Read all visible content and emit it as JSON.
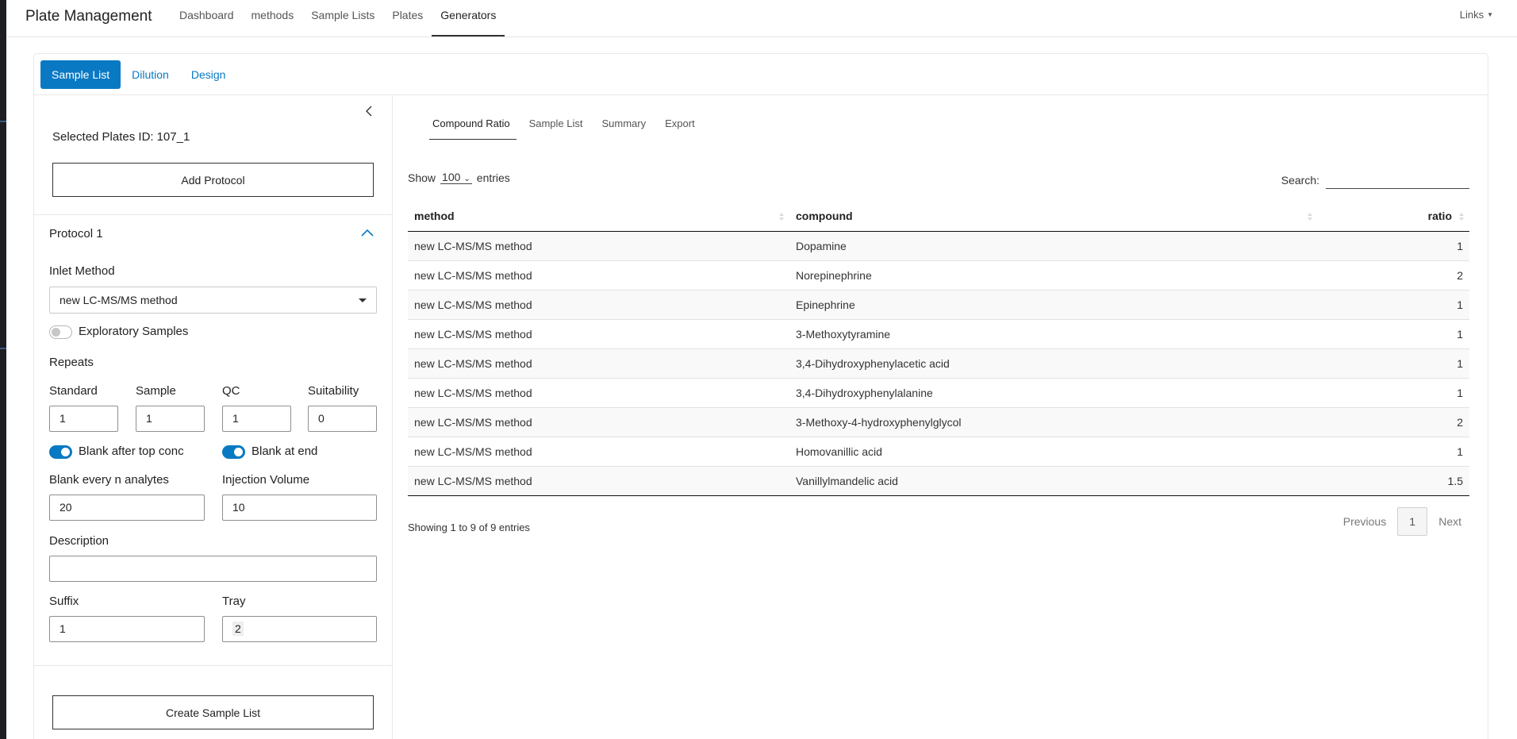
{
  "navbar": {
    "brand": "Plate Management",
    "items": [
      {
        "label": "Dashboard"
      },
      {
        "label": "methods"
      },
      {
        "label": "Sample Lists"
      },
      {
        "label": "Plates"
      },
      {
        "label": "Generators"
      }
    ],
    "active": "Generators",
    "links_label": "Links"
  },
  "generator_tabs": [
    {
      "label": "Sample List"
    },
    {
      "label": "Dilution"
    },
    {
      "label": "Design"
    }
  ],
  "sidebar": {
    "selected_plates_label": "Selected Plates ID:",
    "selected_plates_value": "107_1",
    "add_protocol_label": "Add Protocol",
    "protocol_title": "Protocol 1",
    "inlet_method_label": "Inlet Method",
    "inlet_method_value": "new LC-MS/MS method",
    "exploratory_label": "Exploratory Samples",
    "exploratory_on": false,
    "repeats_label": "Repeats",
    "repeats": [
      {
        "label": "Standard",
        "value": "1"
      },
      {
        "label": "Sample",
        "value": "1"
      },
      {
        "label": "QC",
        "value": "1"
      },
      {
        "label": "Suitability",
        "value": "0"
      }
    ],
    "blank_after_top_label": "Blank after top conc",
    "blank_after_top_on": true,
    "blank_at_end_label": "Blank at end",
    "blank_at_end_on": true,
    "blank_every_label": "Blank every n analytes",
    "blank_every_value": "20",
    "injection_volume_label": "Injection Volume",
    "injection_volume_value": "10",
    "description_label": "Description",
    "description_value": "",
    "suffix_label": "Suffix",
    "suffix_value": "1",
    "tray_label": "Tray",
    "tray_value": "2",
    "create_label": "Create Sample List"
  },
  "main": {
    "tabs": [
      {
        "label": "Compound Ratio"
      },
      {
        "label": "Sample List"
      },
      {
        "label": "Summary"
      },
      {
        "label": "Export"
      }
    ],
    "show_label": "Show",
    "entries_value": "100",
    "entries_label": "entries",
    "search_label": "Search:",
    "columns": [
      "method",
      "compound",
      "ratio"
    ],
    "rows": [
      {
        "method": "new LC-MS/MS method",
        "compound": "Dopamine",
        "ratio": "1"
      },
      {
        "method": "new LC-MS/MS method",
        "compound": "Norepinephrine",
        "ratio": "2"
      },
      {
        "method": "new LC-MS/MS method",
        "compound": "Epinephrine",
        "ratio": "1"
      },
      {
        "method": "new LC-MS/MS method",
        "compound": "3-Methoxytyramine",
        "ratio": "1"
      },
      {
        "method": "new LC-MS/MS method",
        "compound": "3,4-Dihydroxyphenylacetic acid",
        "ratio": "1"
      },
      {
        "method": "new LC-MS/MS method",
        "compound": "3,4-Dihydroxyphenylalanine",
        "ratio": "1"
      },
      {
        "method": "new LC-MS/MS method",
        "compound": "3-Methoxy-4-hydroxyphenylglycol",
        "ratio": "2"
      },
      {
        "method": "new LC-MS/MS method",
        "compound": "Homovanillic acid",
        "ratio": "1"
      },
      {
        "method": "new LC-MS/MS method",
        "compound": "Vanillylmandelic acid",
        "ratio": "1.5"
      }
    ],
    "info": "Showing 1 to 9 of 9 entries",
    "pager": {
      "previous": "Previous",
      "page": "1",
      "next": "Next"
    }
  },
  "colors": {
    "accent": "#0a79c3"
  }
}
